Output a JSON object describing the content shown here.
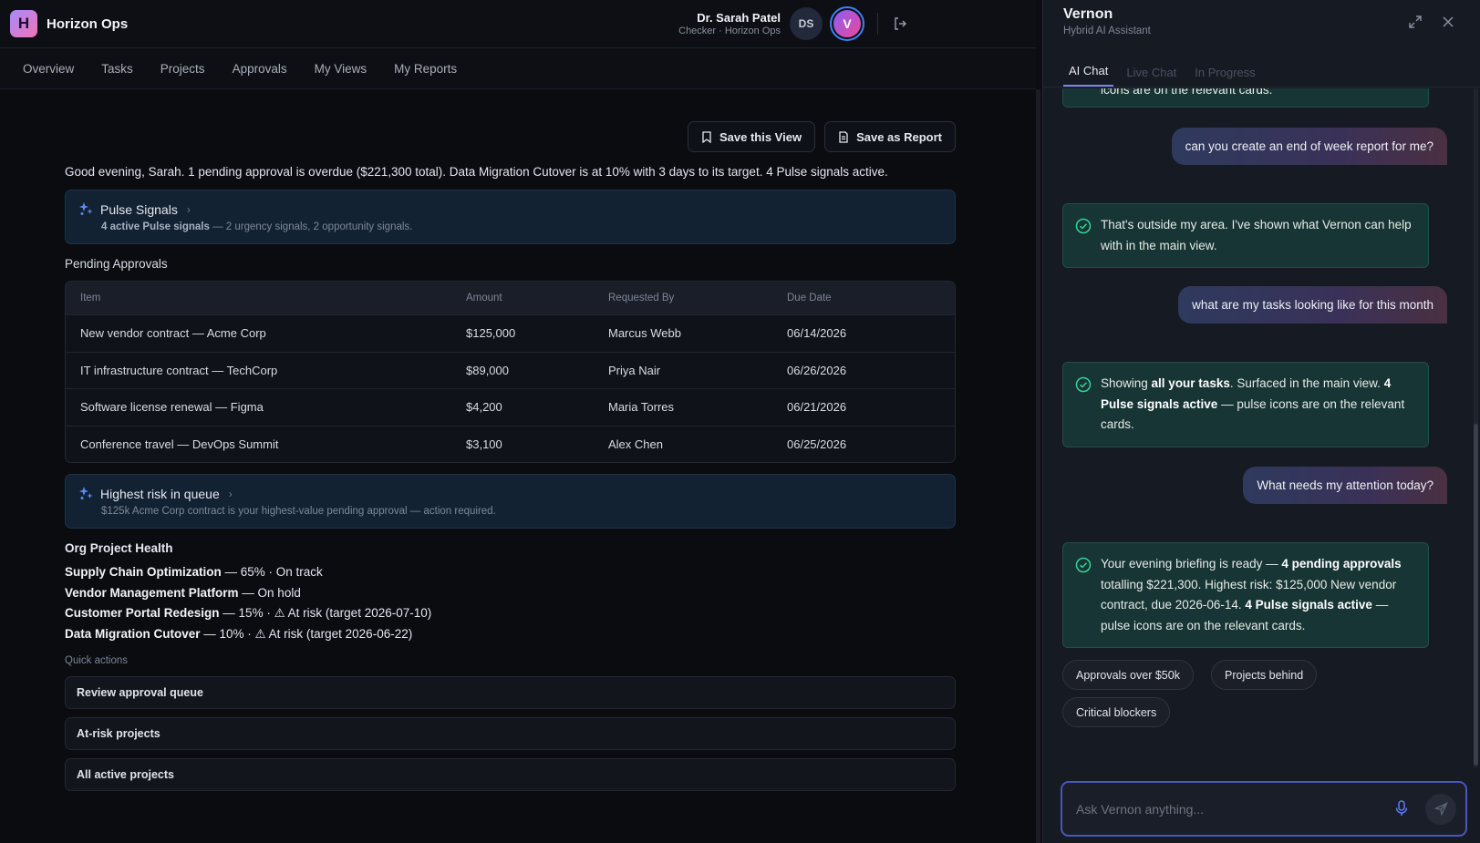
{
  "app": {
    "logo_letter": "H",
    "name": "Horizon Ops",
    "user_name": "Dr. Sarah Patel",
    "user_role": "Checker · Horizon Ops",
    "avatar_initials": "DS",
    "assistant_avatar": "V"
  },
  "nav": [
    "Overview",
    "Tasks",
    "Projects",
    "Approvals",
    "My Views",
    "My Reports"
  ],
  "actions": {
    "save_view": "Save this View",
    "save_report": "Save as Report"
  },
  "greeting": "Good evening, Sarah. 1 pending approval is overdue ($221,300 total). Data Migration Cutover is at 10% with 3 days to its target. 4 Pulse signals active.",
  "pulse_card": {
    "title": "Pulse Signals",
    "sub_bold": "4 active Pulse signals",
    "sub_rest": " — 2 urgency signals, 2 opportunity signals."
  },
  "approvals": {
    "title": "Pending Approvals",
    "headers": [
      "Item",
      "Amount",
      "Requested By",
      "Due Date"
    ],
    "rows": [
      [
        "New vendor contract — Acme Corp",
        "$125,000",
        "Marcus Webb",
        "06/14/2026"
      ],
      [
        "IT infrastructure contract — TechCorp",
        "$89,000",
        "Priya Nair",
        "06/26/2026"
      ],
      [
        "Software license renewal — Figma",
        "$4,200",
        "Maria Torres",
        "06/21/2026"
      ],
      [
        "Conference travel — DevOps Summit",
        "$3,100",
        "Alex Chen",
        "06/25/2026"
      ]
    ]
  },
  "risk_card": {
    "title": "Highest risk in queue",
    "sub": "$125k Acme Corp contract is your highest-value pending approval — action required."
  },
  "health": {
    "title": "Org Project Health",
    "items": [
      {
        "name": "Supply Chain Optimization",
        "detail": " — 65% · On track"
      },
      {
        "name": "Vendor Management Platform",
        "detail": " — On hold"
      },
      {
        "name": "Customer Portal Redesign",
        "detail": " — 15% · ⚠ At risk (target 2026-07-10)"
      },
      {
        "name": "Data Migration Cutover",
        "detail": " — 10% · ⚠ At risk (target 2026-06-22)"
      }
    ]
  },
  "quick_actions": {
    "label": "Quick actions",
    "items": [
      "Review approval queue",
      "At-risk projects",
      "All active projects"
    ]
  },
  "panel": {
    "title": "Vernon",
    "subtitle": "Hybrid AI Assistant",
    "tabs": [
      "AI Chat",
      "Live Chat",
      "In Progress"
    ]
  },
  "chat": {
    "partial_top": "icons are on the relevant cards.",
    "user1": "can you create an end of week report for me?",
    "bot1": "That's outside my area. I've shown what Vernon can help with in the main view.",
    "user2": "what are my tasks looking like for this month",
    "bot2": {
      "p1": "Showing ",
      "b1": "all your tasks",
      "p2": ". Surfaced in the main view. ",
      "b2": "4 Pulse signals active",
      "p3": " — pulse icons are on the relevant cards."
    },
    "user3": "What needs my attention today?",
    "bot3": {
      "p1": "Your evening briefing is ready — ",
      "b1": "4 pending approvals",
      "p2": " totalling $221,300. Highest risk: $125,000 New vendor contract, due 2026-06-14. ",
      "b2": "4 Pulse signals active",
      "p3": " — pulse icons are on the relevant cards."
    },
    "chips": [
      "Approvals over $50k",
      "Projects behind",
      "Critical blockers"
    ]
  },
  "input": {
    "placeholder": "Ask Vernon anything..."
  },
  "icons": {
    "pulse": "pulse-sparkle-icon",
    "check": "check-circle-icon",
    "bookmark": "bookmark-icon",
    "report": "document-icon",
    "logout": "logout-icon",
    "expand": "expand-icon",
    "close": "close-icon",
    "mic": "mic-icon",
    "send": "send-icon"
  },
  "colors": {
    "accent": "#7c83f6",
    "bot_bubble": "#173534",
    "signal_card": "#132233",
    "check": "#34d399"
  }
}
